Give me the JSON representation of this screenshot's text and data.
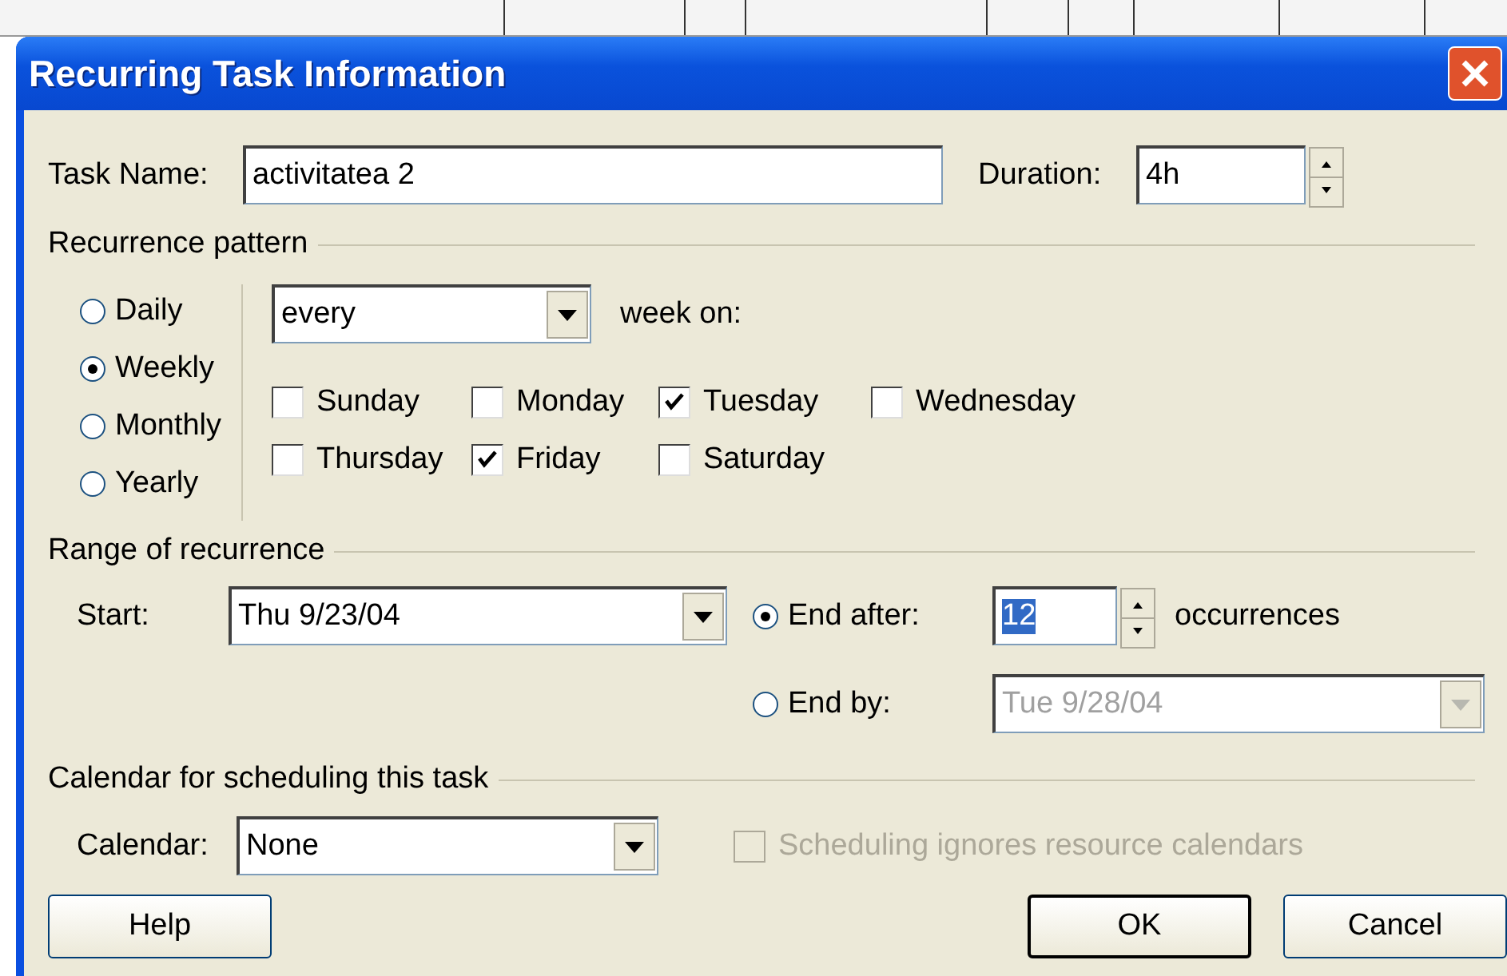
{
  "window": {
    "title": "Recurring Task Information"
  },
  "task_name": {
    "label": "Task Name:",
    "value": "activitatea 2"
  },
  "duration": {
    "label": "Duration:",
    "value": "4h"
  },
  "recurrence_pattern": {
    "title": "Recurrence pattern",
    "frequencies": [
      {
        "label": "Daily",
        "selected": false
      },
      {
        "label": "Weekly",
        "selected": true
      },
      {
        "label": "Monthly",
        "selected": false
      },
      {
        "label": "Yearly",
        "selected": false
      }
    ],
    "interval": {
      "value": "every",
      "suffix": "week on:"
    },
    "days": [
      {
        "label": "Sunday",
        "checked": false
      },
      {
        "label": "Monday",
        "checked": false
      },
      {
        "label": "Tuesday",
        "checked": true
      },
      {
        "label": "Wednesday",
        "checked": false
      },
      {
        "label": "Thursday",
        "checked": false
      },
      {
        "label": "Friday",
        "checked": true
      },
      {
        "label": "Saturday",
        "checked": false
      }
    ]
  },
  "range": {
    "title": "Range of recurrence",
    "start": {
      "label": "Start:",
      "value": "Thu 9/23/04"
    },
    "end_after": {
      "label": "End after:",
      "selected": true,
      "value": "12",
      "value_highlighted": true,
      "suffix": "occurrences"
    },
    "end_by": {
      "label": "End by:",
      "selected": false,
      "value": "Tue 9/28/04",
      "disabled": true
    }
  },
  "calendar": {
    "title": "Calendar for scheduling this task",
    "label": "Calendar:",
    "value": "None",
    "ignore_resource_calendars": {
      "label": "Scheduling ignores resource calendars",
      "checked": false,
      "disabled": true
    }
  },
  "buttons": [
    {
      "label": "Help",
      "default": false
    },
    {
      "label": "OK",
      "default": true
    },
    {
      "label": "Cancel",
      "default": false
    }
  ]
}
